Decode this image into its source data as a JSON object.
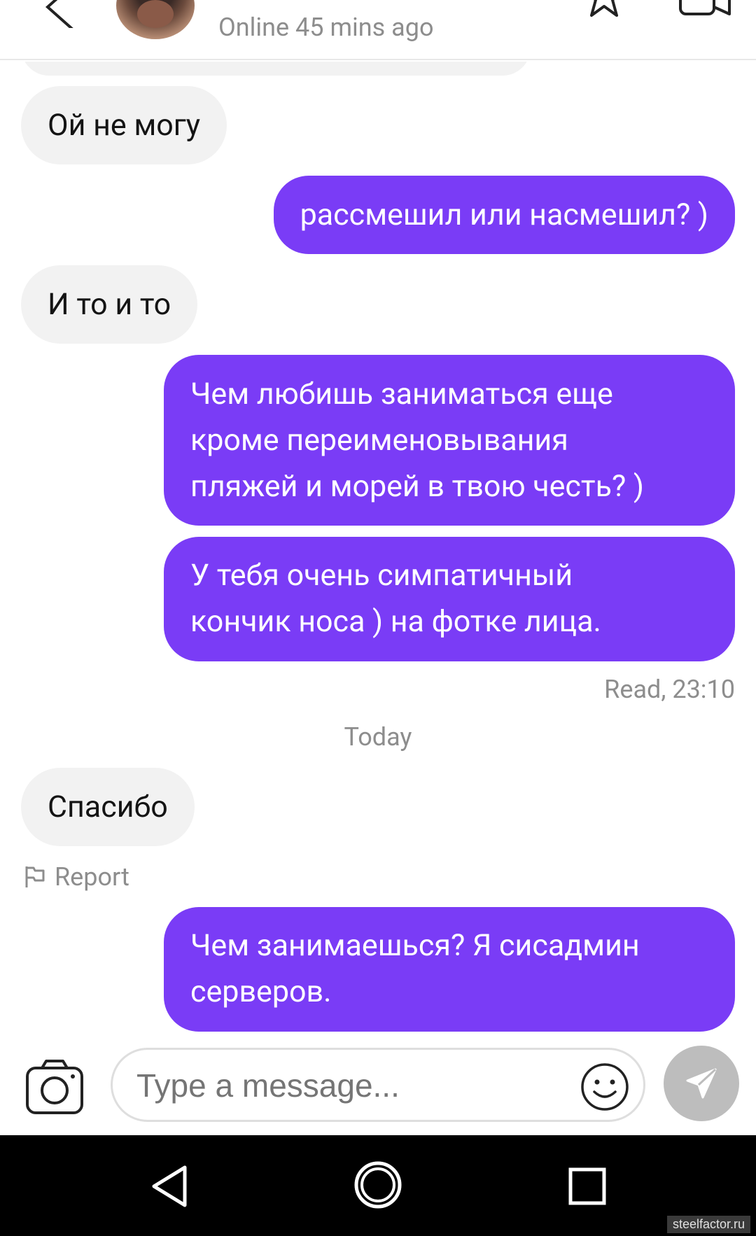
{
  "header": {
    "status": "Online 45 mins ago",
    "icons": [
      "back-arrow-icon",
      "star-icon",
      "video-camera-icon"
    ]
  },
  "messages": [
    {
      "side": "in",
      "text": "Ой не могу"
    },
    {
      "side": "out",
      "text": "рассмешил или насмешил? )"
    },
    {
      "side": "in",
      "text": "И то и то"
    },
    {
      "side": "out",
      "lines": [
        "Чем любишь заниматься еще",
        "кроме переименовывания",
        "пляжей и морей в твою честь? )"
      ]
    },
    {
      "side": "out",
      "lines": [
        "У тебя очень симпатичный",
        "кончик носа ) на фотке лица."
      ]
    },
    {
      "side": "in",
      "text": "Спасибо"
    },
    {
      "side": "out",
      "lines": [
        "Чем занимаешься? Я сисадмин",
        "серверов."
      ]
    }
  ],
  "read_receipt": "Read, 23:10",
  "date_separator": "Today",
  "report_label": "Report",
  "composer": {
    "placeholder": "Type a message...",
    "icons": [
      "camera-icon",
      "emoji-icon",
      "send-icon"
    ]
  },
  "navbar": {
    "icons": [
      "nav-back-icon",
      "nav-home-icon",
      "nav-recents-icon"
    ]
  },
  "watermark": "steelfactor.ru",
  "colors": {
    "outgoing_bubble": "#7a3cf6",
    "incoming_bubble": "#f2f2f2",
    "muted_text": "#8d8d8d",
    "send_button": "#bdbdbd"
  }
}
